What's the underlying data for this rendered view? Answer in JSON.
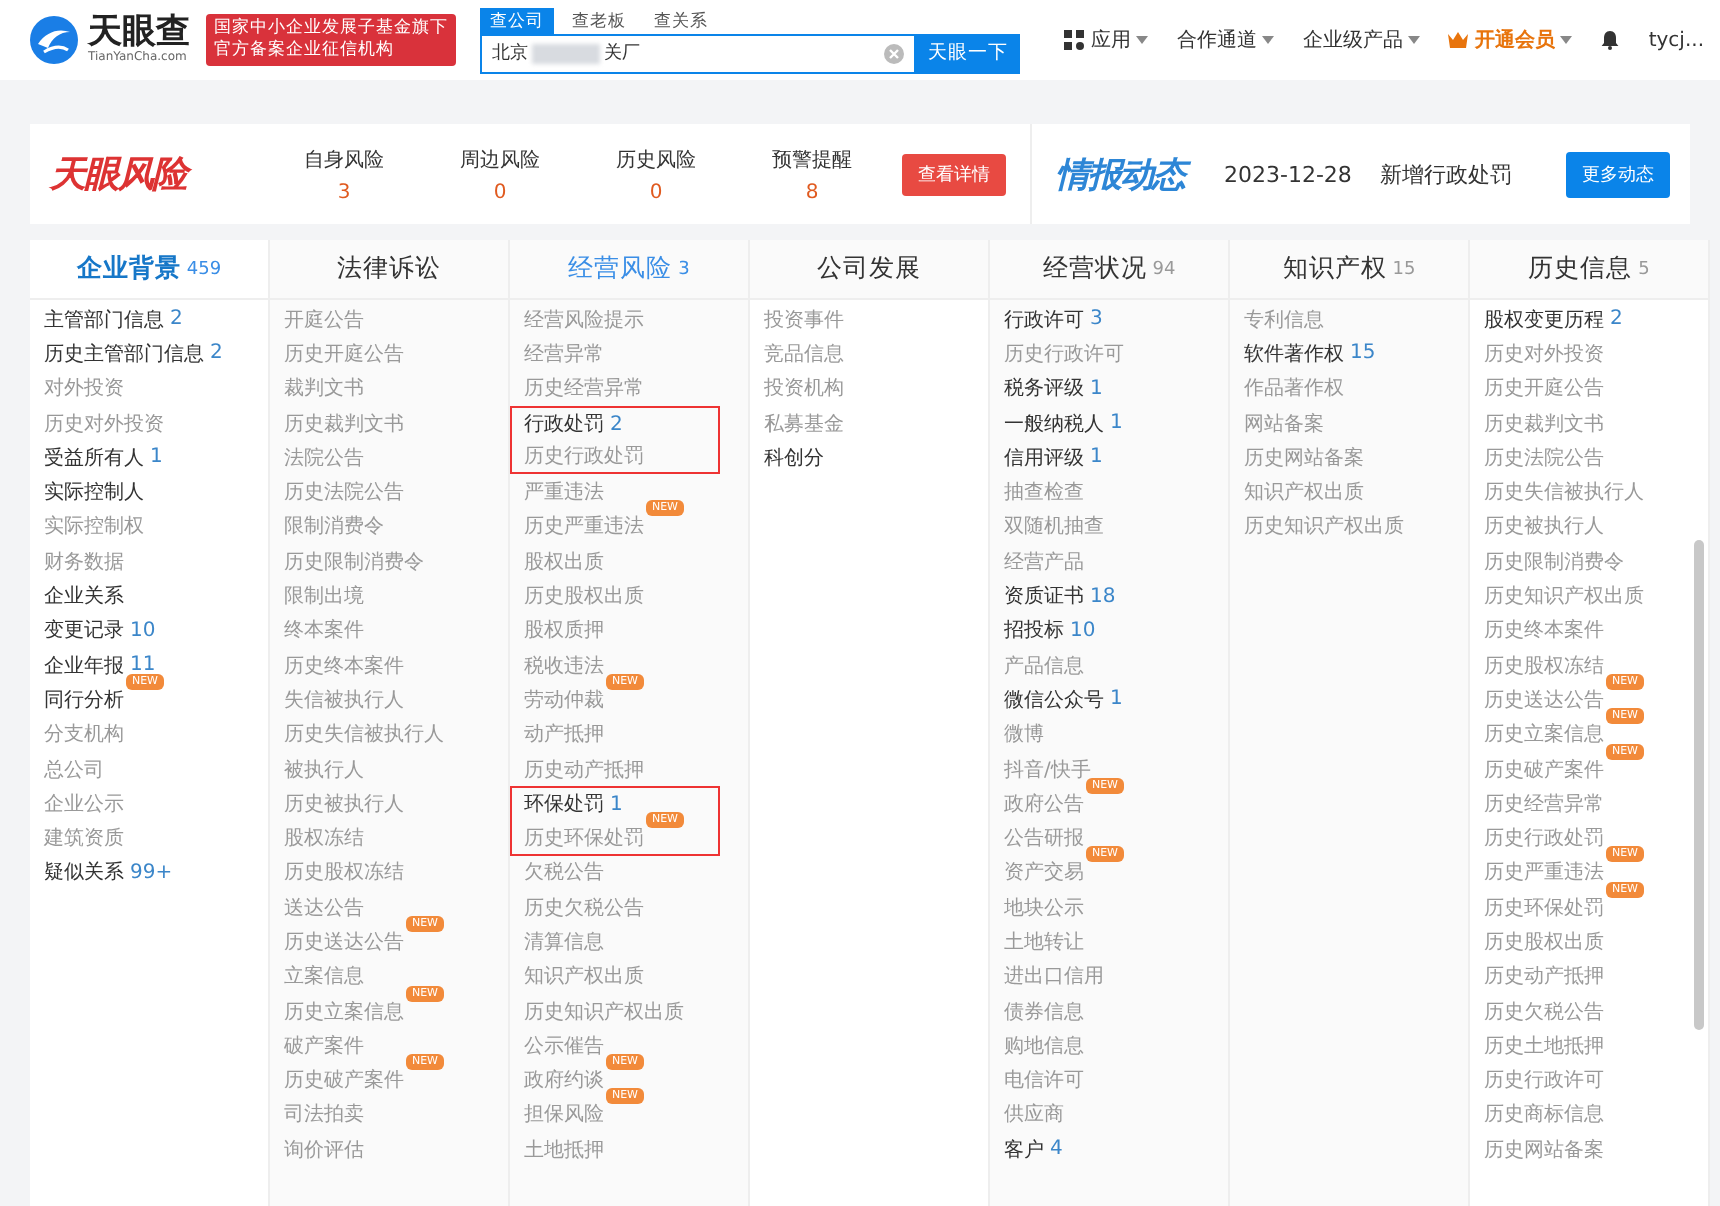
{
  "header": {
    "logo": {
      "name": "天眼查",
      "domain": "TianYanCha.com"
    },
    "banner": [
      "国家中小企业发展子基金旗下",
      "官方备案企业征信机构"
    ],
    "search_tabs": [
      {
        "label": "查公司",
        "selected": true
      },
      {
        "label": "查老板",
        "selected": false
      },
      {
        "label": "查关系",
        "selected": false
      }
    ],
    "search": {
      "value_before_redaction": "北京",
      "value_after_redaction": "关厂",
      "button": "天眼一下"
    },
    "nav": [
      {
        "label": "应用",
        "kind": "apps"
      },
      {
        "label": "合作通道",
        "kind": "plain"
      },
      {
        "label": "企业级产品",
        "kind": "plain"
      },
      {
        "label": "开通会员",
        "kind": "vip"
      }
    ],
    "user": "tycj..."
  },
  "risk": {
    "title": "天眼风险",
    "stats": [
      {
        "label": "自身风险",
        "value": "3"
      },
      {
        "label": "周边风险",
        "value": "0"
      },
      {
        "label": "历史风险",
        "value": "0"
      },
      {
        "label": "预警提醒",
        "value": "8"
      }
    ],
    "button": "查看详情"
  },
  "news": {
    "title": "情报动态",
    "date": "2023-12-28",
    "text": "新增行政处罚",
    "button": "更多动态"
  },
  "tabs": [
    {
      "label": "企业背景",
      "count": "459",
      "selected": true,
      "hovered": false,
      "items": [
        {
          "label": "主管部门信息",
          "count": "2",
          "active": true
        },
        {
          "label": "历史主管部门信息",
          "count": "2",
          "active": true
        },
        {
          "label": "对外投资",
          "active": false
        },
        {
          "label": "历史对外投资",
          "active": false
        },
        {
          "label": "受益所有人",
          "count": "1",
          "active": true
        },
        {
          "label": "实际控制人",
          "active": true
        },
        {
          "label": "实际控制权",
          "active": false
        },
        {
          "label": "财务数据",
          "active": false
        },
        {
          "label": "企业关系",
          "active": true
        },
        {
          "label": "变更记录",
          "count": "10",
          "active": true
        },
        {
          "label": "企业年报",
          "count": "11",
          "active": true
        },
        {
          "label": "同行分析",
          "active": true,
          "badge": "NEW"
        },
        {
          "label": "分支机构",
          "active": false
        },
        {
          "label": "总公司",
          "active": false
        },
        {
          "label": "企业公示",
          "active": false
        },
        {
          "label": "建筑资质",
          "active": false
        },
        {
          "label": "疑似关系",
          "count": "99+",
          "active": true
        }
      ]
    },
    {
      "label": "法律诉讼",
      "selected": false,
      "hovered": false,
      "items": [
        {
          "label": "开庭公告",
          "active": false
        },
        {
          "label": "历史开庭公告",
          "active": false
        },
        {
          "label": "裁判文书",
          "active": false
        },
        {
          "label": "历史裁判文书",
          "active": false
        },
        {
          "label": "法院公告",
          "active": false
        },
        {
          "label": "历史法院公告",
          "active": false
        },
        {
          "label": "限制消费令",
          "active": false
        },
        {
          "label": "历史限制消费令",
          "active": false
        },
        {
          "label": "限制出境",
          "active": false
        },
        {
          "label": "终本案件",
          "active": false
        },
        {
          "label": "历史终本案件",
          "active": false
        },
        {
          "label": "失信被执行人",
          "active": false
        },
        {
          "label": "历史失信被执行人",
          "active": false
        },
        {
          "label": "被执行人",
          "active": false
        },
        {
          "label": "历史被执行人",
          "active": false
        },
        {
          "label": "股权冻结",
          "active": false
        },
        {
          "label": "历史股权冻结",
          "active": false
        },
        {
          "label": "送达公告",
          "active": false
        },
        {
          "label": "历史送达公告",
          "active": false,
          "badge": "NEW"
        },
        {
          "label": "立案信息",
          "active": false
        },
        {
          "label": "历史立案信息",
          "active": false,
          "badge": "NEW"
        },
        {
          "label": "破产案件",
          "active": false
        },
        {
          "label": "历史破产案件",
          "active": false,
          "badge": "NEW"
        },
        {
          "label": "司法拍卖",
          "active": false
        },
        {
          "label": "询价评估",
          "active": false
        }
      ]
    },
    {
      "label": "经营风险",
      "count": "3",
      "selected": false,
      "hovered": true,
      "items": [
        {
          "label": "经营风险提示",
          "active": false
        },
        {
          "label": "经营异常",
          "active": false
        },
        {
          "label": "历史经营异常",
          "active": false
        },
        {
          "label": "行政处罚",
          "count": "2",
          "active": true,
          "highlighted": true
        },
        {
          "label": "历史行政处罚",
          "active": false,
          "highlighted": true
        },
        {
          "label": "严重违法",
          "active": false
        },
        {
          "label": "历史严重违法",
          "active": false,
          "badge": "NEW"
        },
        {
          "label": "股权出质",
          "active": false
        },
        {
          "label": "历史股权出质",
          "active": false
        },
        {
          "label": "股权质押",
          "active": false
        },
        {
          "label": "税收违法",
          "active": false
        },
        {
          "label": "劳动仲裁",
          "active": false,
          "badge": "NEW"
        },
        {
          "label": "动产抵押",
          "active": false
        },
        {
          "label": "历史动产抵押",
          "active": false
        },
        {
          "label": "环保处罚",
          "count": "1",
          "active": true,
          "highlighted": true
        },
        {
          "label": "历史环保处罚",
          "active": false,
          "badge": "NEW",
          "highlighted": true
        },
        {
          "label": "欠税公告",
          "active": false
        },
        {
          "label": "历史欠税公告",
          "active": false
        },
        {
          "label": "清算信息",
          "active": false
        },
        {
          "label": "知识产权出质",
          "active": false
        },
        {
          "label": "历史知识产权出质",
          "active": false
        },
        {
          "label": "公示催告",
          "active": false
        },
        {
          "label": "政府约谈",
          "active": false,
          "badge": "NEW"
        },
        {
          "label": "担保风险",
          "active": false,
          "badge": "NEW"
        },
        {
          "label": "土地抵押",
          "active": false
        }
      ]
    },
    {
      "label": "公司发展",
      "selected": false,
      "hovered": false,
      "items": [
        {
          "label": "投资事件",
          "active": false
        },
        {
          "label": "竞品信息",
          "active": false
        },
        {
          "label": "投资机构",
          "active": false
        },
        {
          "label": "私募基金",
          "active": false
        },
        {
          "label": "科创分",
          "active": true
        }
      ]
    },
    {
      "label": "经营状况",
      "count": "94",
      "selected": false,
      "hovered": false,
      "items": [
        {
          "label": "行政许可",
          "count": "3",
          "active": true
        },
        {
          "label": "历史行政许可",
          "active": false
        },
        {
          "label": "税务评级",
          "count": "1",
          "active": true
        },
        {
          "label": "一般纳税人",
          "count": "1",
          "active": true
        },
        {
          "label": "信用评级",
          "count": "1",
          "active": true
        },
        {
          "label": "抽查检查",
          "active": false
        },
        {
          "label": "双随机抽查",
          "active": false
        },
        {
          "label": "经营产品",
          "active": false
        },
        {
          "label": "资质证书",
          "count": "18",
          "active": true
        },
        {
          "label": "招投标",
          "count": "10",
          "active": true
        },
        {
          "label": "产品信息",
          "active": false
        },
        {
          "label": "微信公众号",
          "count": "1",
          "active": true
        },
        {
          "label": "微博",
          "active": false
        },
        {
          "label": "抖音/快手",
          "active": false
        },
        {
          "label": "政府公告",
          "active": false,
          "badge": "NEW"
        },
        {
          "label": "公告研报",
          "active": false
        },
        {
          "label": "资产交易",
          "active": false,
          "badge": "NEW"
        },
        {
          "label": "地块公示",
          "active": false
        },
        {
          "label": "土地转让",
          "active": false
        },
        {
          "label": "进出口信用",
          "active": false
        },
        {
          "label": "债券信息",
          "active": false
        },
        {
          "label": "购地信息",
          "active": false
        },
        {
          "label": "电信许可",
          "active": false
        },
        {
          "label": "供应商",
          "active": false
        },
        {
          "label": "客户",
          "count": "4",
          "active": true
        }
      ]
    },
    {
      "label": "知识产权",
      "count": "15",
      "selected": false,
      "hovered": false,
      "items": [
        {
          "label": "专利信息",
          "active": false
        },
        {
          "label": "软件著作权",
          "count": "15",
          "active": true
        },
        {
          "label": "作品著作权",
          "active": false
        },
        {
          "label": "网站备案",
          "active": false
        },
        {
          "label": "历史网站备案",
          "active": false
        },
        {
          "label": "知识产权出质",
          "active": false
        },
        {
          "label": "历史知识产权出质",
          "active": false
        }
      ]
    },
    {
      "label": "历史信息",
      "count": "5",
      "selected": false,
      "hovered": false,
      "items": [
        {
          "label": "股权变更历程",
          "count": "2",
          "active": true
        },
        {
          "label": "历史对外投资",
          "active": false
        },
        {
          "label": "历史开庭公告",
          "active": false
        },
        {
          "label": "历史裁判文书",
          "active": false
        },
        {
          "label": "历史法院公告",
          "active": false
        },
        {
          "label": "历史失信被执行人",
          "active": false
        },
        {
          "label": "历史被执行人",
          "active": false
        },
        {
          "label": "历史限制消费令",
          "active": false
        },
        {
          "label": "历史知识产权出质",
          "active": false
        },
        {
          "label": "历史终本案件",
          "active": false
        },
        {
          "label": "历史股权冻结",
          "active": false
        },
        {
          "label": "历史送达公告",
          "active": false,
          "badge": "NEW"
        },
        {
          "label": "历史立案信息",
          "active": false,
          "badge": "NEW"
        },
        {
          "label": "历史破产案件",
          "active": false,
          "badge": "NEW"
        },
        {
          "label": "历史经营异常",
          "active": false
        },
        {
          "label": "历史行政处罚",
          "active": false
        },
        {
          "label": "历史严重违法",
          "active": false,
          "badge": "NEW"
        },
        {
          "label": "历史环保处罚",
          "active": false,
          "badge": "NEW"
        },
        {
          "label": "历史股权出质",
          "active": false
        },
        {
          "label": "历史动产抵押",
          "active": false
        },
        {
          "label": "历史欠税公告",
          "active": false
        },
        {
          "label": "历史土地抵押",
          "active": false
        },
        {
          "label": "历史行政许可",
          "active": false
        },
        {
          "label": "历史商标信息",
          "active": false
        },
        {
          "label": "历史网站备案",
          "active": false
        }
      ]
    }
  ]
}
